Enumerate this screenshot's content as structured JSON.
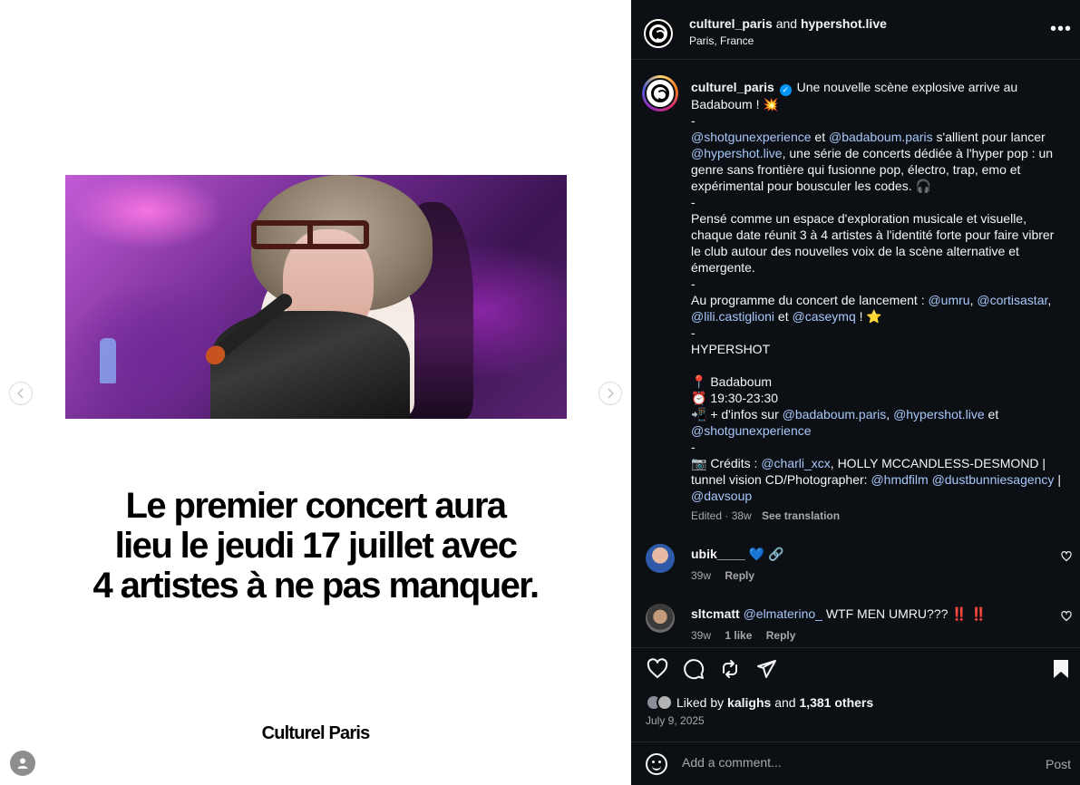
{
  "post": {
    "headline_lines": [
      "Le premier concert aura",
      "lieu le jeudi 17 juillet avec",
      "4 artistes à ne pas manquer."
    ],
    "brand": "Culturel Paris"
  },
  "header": {
    "author": "culturel_paris",
    "and": "and",
    "collaborator": "hypershot.live",
    "location": "Paris, France",
    "more": "•••"
  },
  "caption": {
    "user": "culturel_paris",
    "verified": "✓",
    "l1": "Une nouvelle scène explosive arrive au Badaboum ! 💥",
    "dash": "-",
    "m_shotgun": "@shotgunexperience",
    "t_et": "et",
    "m_badaboum": "@badaboum.paris",
    "t_allient": "s'allient pour lancer",
    "m_hypershot": "@hypershot.live",
    "t_serie": ", une série de concerts dédiée à l'hyper pop : un genre sans frontière qui fusionne pop, électro, trap, emo et expérimental pour bousculer les codes. 🎧",
    "p2": "Pensé comme un espace d'exploration musicale et visuelle, chaque date réunit 3 à 4 artistes à l'identité forte pour faire vibrer le club autour des nouvelles voix de la scène alternative et émergente.",
    "t_programme": "Au programme du concert de lancement :",
    "m_umru": "@umru",
    "comma": ",",
    "m_cortisastar": "@cortisastar",
    "m_lili": "@lili.castiglioni",
    "m_casey": "@caseymq",
    "t_star": "! ⭐",
    "t_hypershot": "HYPERSHOT",
    "t_place": "📍 Badaboum",
    "t_time": "⏰ 19:30-23:30",
    "t_infos": "📲 + d'infos sur",
    "t_credits": "📷 Crédits :",
    "m_charli": "@charli_xcx",
    "t_holly": ", HOLLY MCCANDLESS-DESMOND | tunnel vision CD/Photographer:",
    "m_hmd": "@hmdfilm",
    "m_dust": "@dustbunniesagency",
    "t_pipe": "|",
    "m_davsoup": "@davsoup",
    "edited": "Edited · 38w",
    "see_translation": "See translation"
  },
  "comments": [
    {
      "user": "ubik____",
      "text": "💙 🔗",
      "time": "39w",
      "likes": "",
      "reply": "Reply"
    },
    {
      "user": "sltcmatt",
      "mention": "@elmaterino_",
      "text": "WTF MEN UMRU??? ‼️ ‼️",
      "time": "39w",
      "likes": "1 like",
      "reply": "Reply"
    }
  ],
  "likes": {
    "prefix": "Liked by",
    "user": "kalighs",
    "and": "and",
    "others": "1,381 others"
  },
  "date": "July 9, 2025",
  "add_comment": {
    "placeholder": "Add a comment...",
    "post": "Post"
  },
  "icons": [
    "chevron-left-icon",
    "chevron-right-icon",
    "heart-icon",
    "comment-icon",
    "repost-icon",
    "share-icon",
    "bookmark-icon",
    "emoji-icon",
    "user-icon"
  ]
}
